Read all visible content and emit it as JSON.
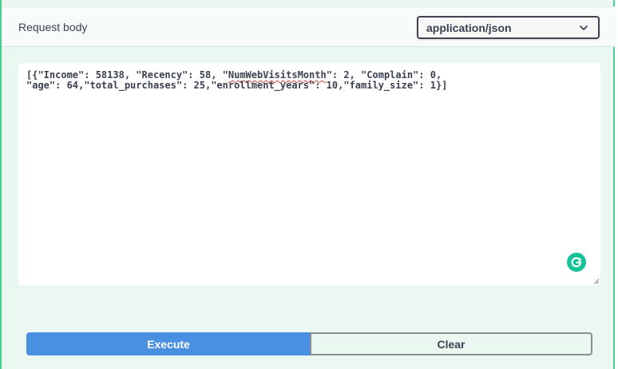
{
  "request_body": {
    "title": "Request body",
    "content_type": {
      "selected": "application/json",
      "icon": "chevron-down-icon"
    }
  },
  "editor": {
    "line1_part1": "[{\"Income\": 58138, \"Recency\": 58, \"",
    "line1_flagged": "NumWebVisitsMonth",
    "line1_part2": "\": 2, \"Complain\": 0,",
    "line2": "\"age\": 64,\"total_purchases\": 25,\"enrollment_years\": 10,\"family_size\": 1}]",
    "assistant_icon": "grammarly-icon"
  },
  "actions": {
    "execute_label": "Execute",
    "clear_label": "Clear"
  },
  "colors": {
    "panel_bg": "#ebf7f1",
    "panel_border": "#49cc90",
    "execute_bg": "#4990e2",
    "grammarly": "#15c39a",
    "spell_underline": "#d0463c"
  }
}
